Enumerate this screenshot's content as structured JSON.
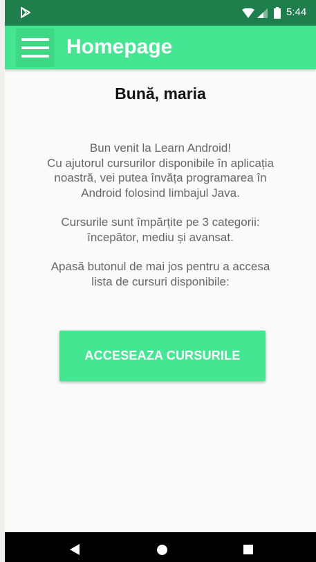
{
  "status_bar": {
    "time": "5:44",
    "icons": [
      "play-store-icon",
      "wifi-icon",
      "signal-icon",
      "battery-icon"
    ]
  },
  "app_bar": {
    "title": "Homepage",
    "menu_icon": "hamburger-menu-icon"
  },
  "content": {
    "greeting": "Bună, maria",
    "intro_lines": [
      "Bun venit la Learn Android!",
      "Cu ajutorul cursurilor disponibile în aplicația",
      "noastră, vei putea învăța programarea în",
      "Android folosind limbajul Java."
    ],
    "categories_lines": [
      "Cursurile sunt împărțite pe 3 categorii:",
      "începător, mediu și avansat."
    ],
    "instruction_lines": [
      "Apasă butonul de mai jos pentru a accesa",
      "lista de cursuri disponibile:"
    ],
    "button_label": "ACCESEAZA CURSURILE"
  },
  "nav_bar": {
    "icons": [
      "back-icon",
      "home-icon",
      "recents-icon"
    ]
  },
  "colors": {
    "status_bar": "#1e7e4c",
    "accent": "#45e692",
    "menu_button": "#3dd883",
    "background": "#fafafa",
    "body_text": "#666666",
    "heading_text": "#111111"
  }
}
